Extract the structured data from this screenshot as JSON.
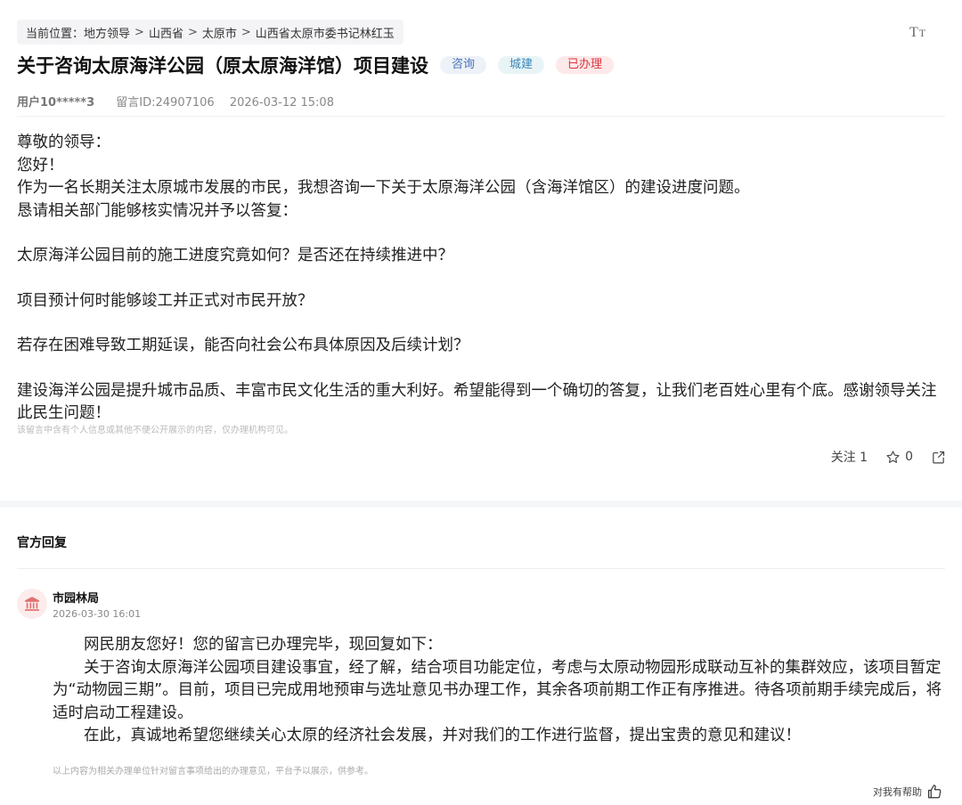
{
  "breadcrumb": {
    "prefix": "当前位置：",
    "items": [
      "地方领导",
      "山西省",
      "太原市",
      "山西省太原市委书记林红玉"
    ],
    "separator": ">"
  },
  "font_size_button": {
    "large": "T",
    "small": "T"
  },
  "message": {
    "title": "关于咨询太原海洋公园（原太原海洋馆）项目建设",
    "tags": [
      "咨询",
      "城建",
      "已办理"
    ],
    "user": "用户10*****3",
    "message_id": "留言ID:24907106",
    "datetime": "2026-03-12 15:08",
    "content": [
      "尊敬的领导：",
      "您好！",
      "作为一名长期关注太原城市发展的市民，我想咨询一下关于太原海洋公园（含海洋馆区）的建设进度问题。",
      "恳请相关部门能够核实情况并予以答复：",
      "太原海洋公园目前的施工进度究竟如何？是否还在持续推进中？",
      "项目预计何时能够竣工并正式对市民开放？",
      "若存在困难导致工期延误，能否向社会公布具体原因及后续计划？",
      "建设海洋公园是提升城市品质、丰富市民文化生活的重大利好。希望能得到一个确切的答复，让我们老百姓心里有个底。感谢领导关注此民生问题！"
    ],
    "privacy_note": "该留言中含有个人信息或其他不便公开展示的内容，仅办理机构可见。"
  },
  "actions": {
    "follow_label": "关注 1",
    "favorite_count": "0"
  },
  "reply": {
    "section_title": "官方回复",
    "org_name": "市园林局",
    "datetime": "2026-03-30 16:01",
    "paragraphs": [
      "网民朋友您好！您的留言已办理完毕，现回复如下：",
      "关于咨询太原海洋公园项目建设事宜，经了解，结合项目功能定位，考虑与太原动物园形成联动互补的集群效应，该项目暂定为“动物园三期”。目前，项目已完成用地预审与选址意见书办理工作，其余各项前期工作正有序推进。待各项前期手续完成后，将适时启动工程建设。",
      "在此，真诚地希望您继续关心太原的经济社会发展，并对我们的工作进行监督，提出宝贵的意见和建议！"
    ],
    "disclaimer": "以上内容为相关办理单位针对留言事项给出的办理意见，平台予以展示，供参考。",
    "helpful_label": "对我有帮助"
  },
  "colors": {
    "tag_blue": "#4a73b8",
    "tag_teal": "#3a86b8",
    "tag_red": "#d9363e",
    "org_logo": "#e07070"
  }
}
